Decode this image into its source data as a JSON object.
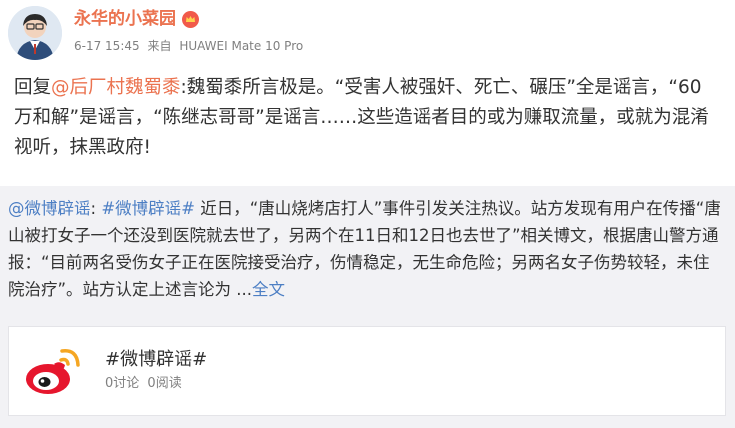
{
  "author": {
    "name": "永华的小菜园"
  },
  "meta": {
    "date": "6-17 15:45",
    "from_label": "来自",
    "device": "HUAWEI Mate 10 Pro"
  },
  "post": {
    "reply_prefix": "回复",
    "mention": "@后厂村魏蜀黍",
    "text": ":魏蜀黍所言极是。“受害人被强奸、死亡、碾压”全是谣言，“60万和解”是谣言，“陈继志哥哥”是谣言……这些造谣者目的或为赚取流量，或就为混淆视听，抹黑政府!"
  },
  "retweet": {
    "mention": "@微博辟谣",
    "colon": ": ",
    "hashtag": "#微博辟谣#",
    "text": " 近日，“唐山烧烤店打人”事件引发关注热议。站方发现有用户在传播“唐山被打女子一个还没到医院就去世了，另两个在11日和12日也去世了”相关博文，根据唐山警方通报：“目前两名受伤女子正在医院接受治疗，伤情稳定，无生命危险；另两名女子伤势较轻，未住院治疗”。站方认定上述言论为 ...",
    "full_text_link": "全文"
  },
  "card": {
    "title": "#微博辟谣#",
    "discussions": "0讨论",
    "reads": "0阅读"
  },
  "colors": {
    "accent": "#eb7350",
    "link_blue": "#4d7fc4",
    "retweet_bg": "#f2f2f5",
    "meta_gray": "#808080"
  },
  "icons": {
    "vip": "vip-crown-badge-icon",
    "card_logo": "weibo-logo-icon"
  }
}
